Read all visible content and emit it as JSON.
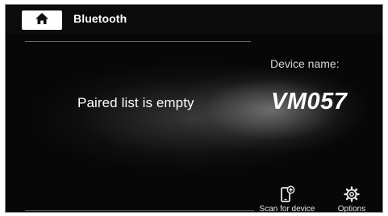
{
  "header": {
    "title": "Bluetooth",
    "home_icon": "home-icon"
  },
  "main": {
    "paired_status": "Paired list is empty",
    "device_name_label": "Device name:",
    "device_name_value": "VM057"
  },
  "actions": {
    "scan_label": "Scan for device",
    "scan_icon": "phone-add-icon",
    "options_label": "Options",
    "options_icon": "gear-icon"
  },
  "colors": {
    "background": "#070707",
    "text": "#ffffff",
    "home_button": "#ffffff"
  }
}
